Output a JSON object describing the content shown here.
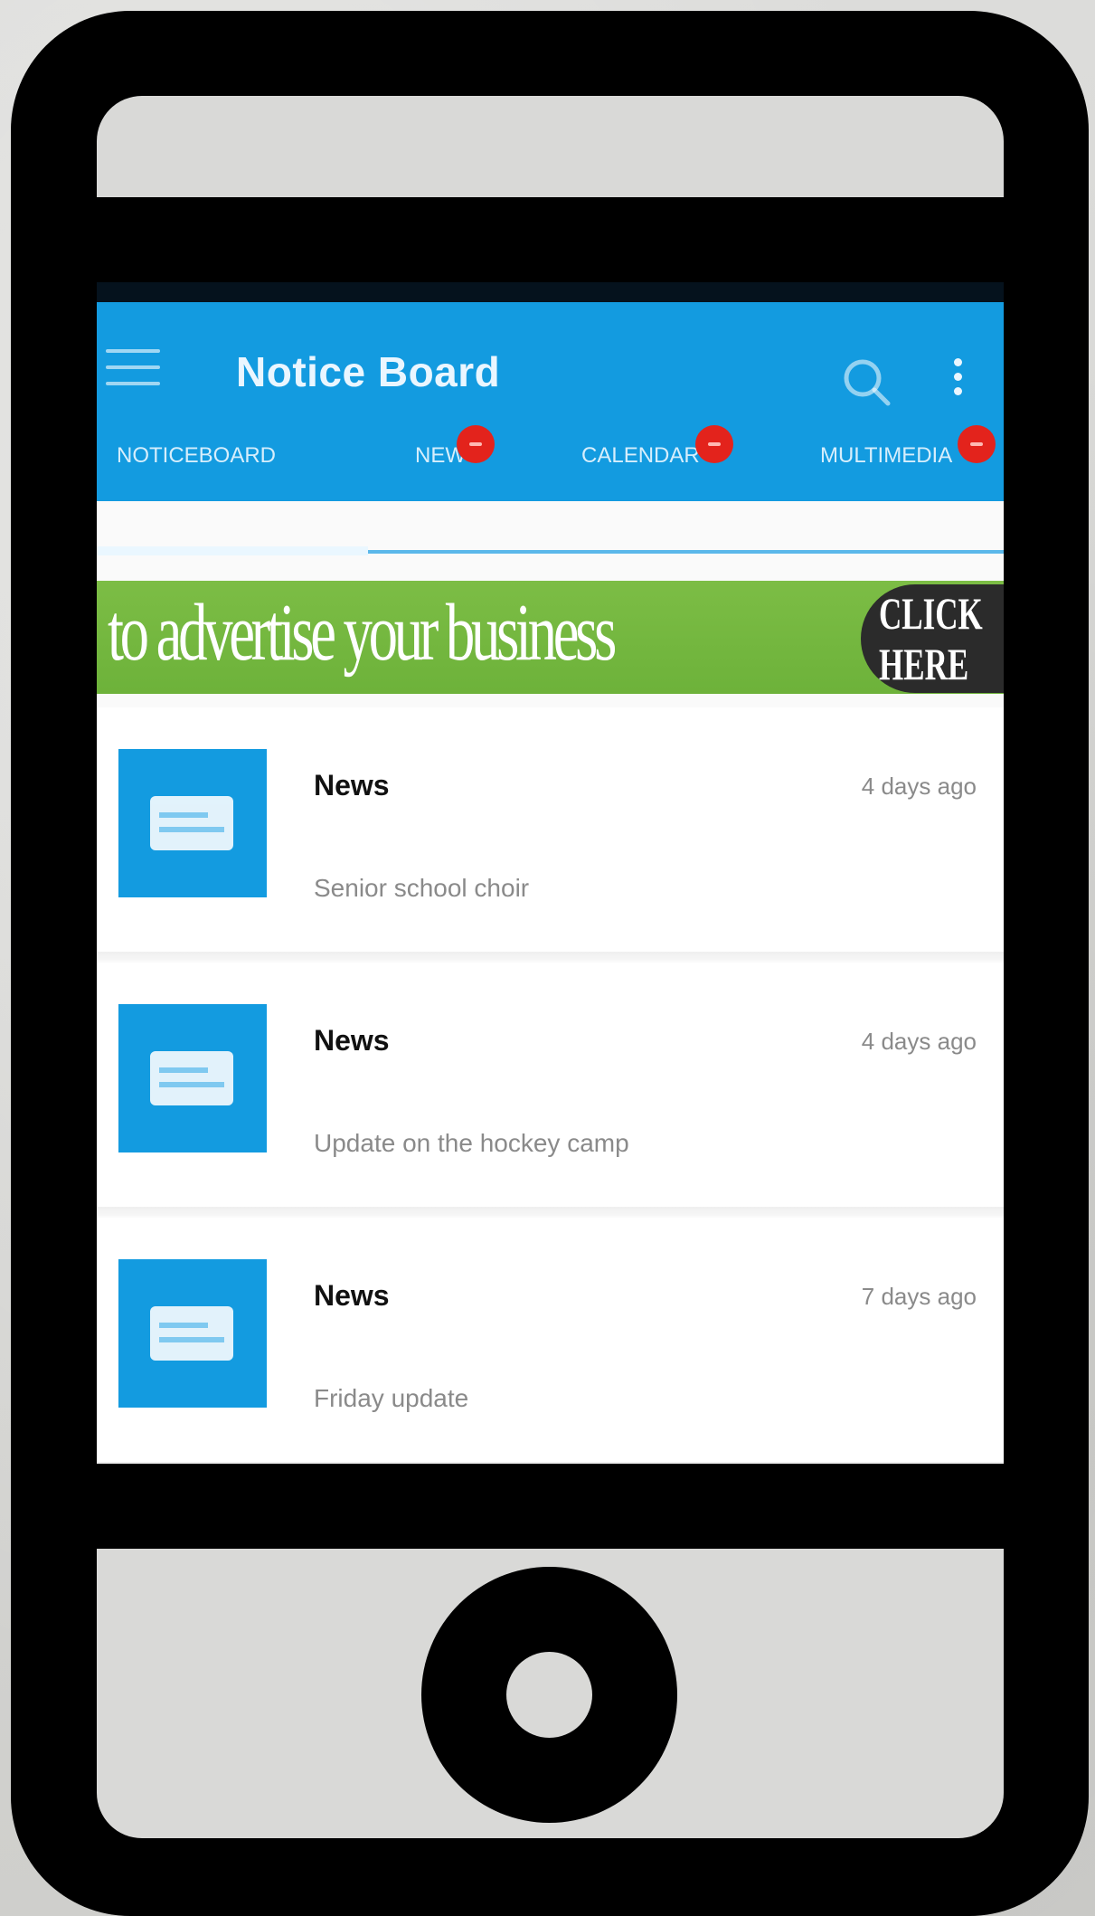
{
  "app": {
    "title": "Notice Board"
  },
  "tabs": [
    {
      "label": "NOTICEBOARD",
      "active": true,
      "badge": false
    },
    {
      "label": "NEWS",
      "active": false,
      "badge": true
    },
    {
      "label": "CALENDAR",
      "active": false,
      "badge": true
    },
    {
      "label": "MULTIMEDIA",
      "active": false,
      "badge": true
    }
  ],
  "ad": {
    "text": "to advertise your business",
    "cta": "CLICK HERE"
  },
  "items": [
    {
      "title": "News",
      "time": "4 days ago",
      "snippet": "Senior school choir"
    },
    {
      "title": "News",
      "time": "4 days ago",
      "snippet": "Update on the hockey camp"
    },
    {
      "title": "News",
      "time": "7 days ago",
      "snippet": "Friday update"
    }
  ],
  "colors": {
    "primary": "#139be0",
    "badge": "#e3231c",
    "ad_green": "#74b83f"
  },
  "icons": {
    "menu": "hamburger-icon",
    "search": "search-icon",
    "overflow": "more-vert-icon",
    "item": "document-icon"
  }
}
